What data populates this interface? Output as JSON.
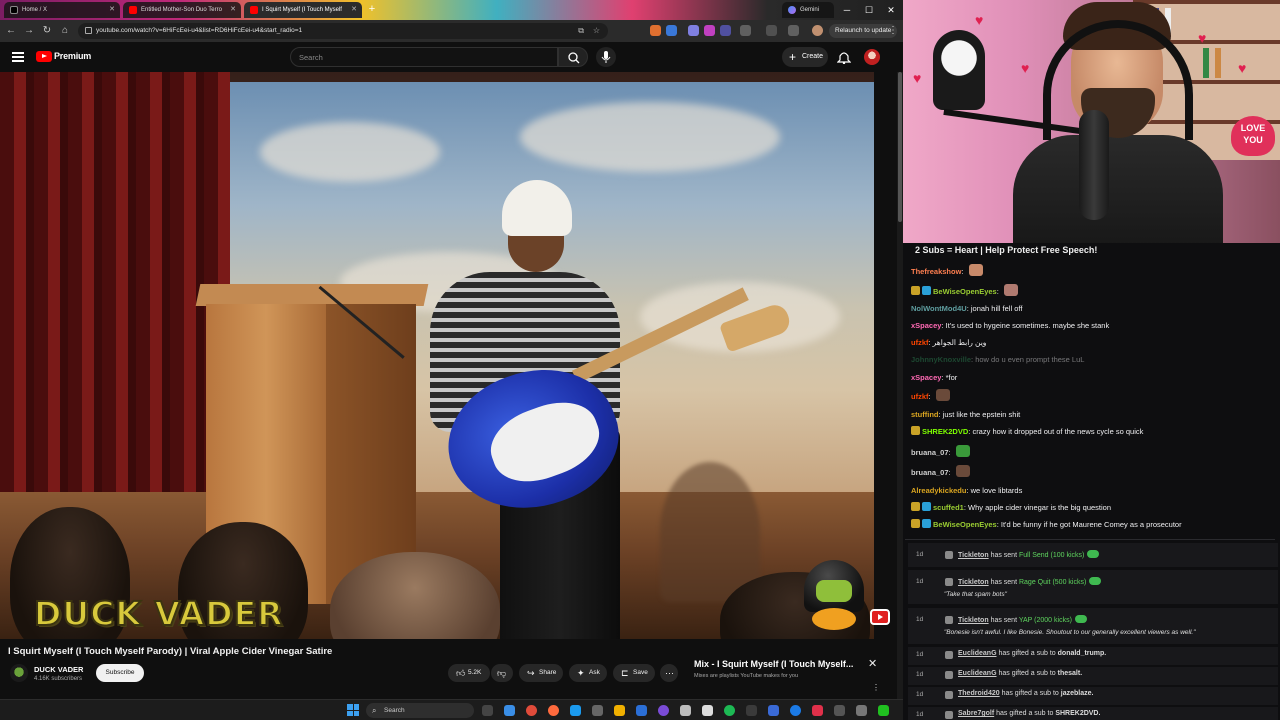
{
  "browser": {
    "tabs": [
      {
        "label": "Home / X",
        "active": false
      },
      {
        "label": "Entitled Mother-Son Duo Terro",
        "active": false
      },
      {
        "label": "I Squirt Myself (I Touch Myself",
        "active": true
      },
      {
        "label": "Gemini",
        "active": false
      }
    ],
    "url": "youtube.com/watch?v=6HiFcEei-u4&list=RD6HiFcEei-u4&start_radio=1",
    "relaunch_label": "Relaunch to update"
  },
  "youtube": {
    "logo_text": "Premium",
    "search_placeholder": "Search",
    "create_label": "Create"
  },
  "video": {
    "watermark": "DUCK VADER",
    "title": "I Squirt Myself (I Touch Myself Parody) | Viral Apple Cider Vinegar Satire",
    "channel": "DUCK VADER",
    "subscribers": "4.16K subscribers",
    "subscribe_label": "Subscribe",
    "likes": "5.2K",
    "share_label": "Share",
    "ask_label": "Ask",
    "save_label": "Save"
  },
  "mix": {
    "title": "Mix - I Squirt Myself (I Touch Myself...",
    "subtitle": "Mixes are playlists YouTube makes for you"
  },
  "taskbar": {
    "search_label": "Search"
  },
  "chat": {
    "banner": "2 Subs = Heart | Help Protect Free Speech!",
    "messages": [
      {
        "user": "Thefreakshow",
        "text": "",
        "color": "#ff7f50",
        "badges": 0,
        "emote": true,
        "dim": false
      },
      {
        "user": "BeWiseOpenEyes",
        "text": "",
        "color": "#9acd32",
        "badges": 2,
        "emote": true,
        "dim": false
      },
      {
        "user": "NolWontMod4U",
        "text": "jonah hill fell off",
        "color": "#5f9ea0",
        "badges": 0,
        "emote": false,
        "dim": false
      },
      {
        "user": "xSpacey",
        "text": "It's used to hygeine sometimes. maybe she stank",
        "color": "#ff69b4",
        "badges": 0,
        "emote": false,
        "dim": false
      },
      {
        "user": "ufzkf",
        "text": "وين رابط الجواهر",
        "color": "#ff4500",
        "badges": 0,
        "emote": false,
        "dim": false
      },
      {
        "user": "JohnnyKnoxville",
        "text": "how do u even prompt these LuL",
        "color": "#2e8b57",
        "badges": 0,
        "emote": false,
        "dim": true
      },
      {
        "user": "xSpacey",
        "text": "*for",
        "color": "#ff69b4",
        "badges": 0,
        "emote": false,
        "dim": false
      },
      {
        "user": "ufzkf",
        "text": "",
        "color": "#ff4500",
        "badges": 0,
        "emote": true,
        "dim": false
      },
      {
        "user": "stuffind",
        "text": "just like the epstein shit",
        "color": "#daa520",
        "badges": 0,
        "emote": false,
        "dim": false
      },
      {
        "user": "SHREK2DVD",
        "text": "crazy how it dropped out of the news cycle so quick",
        "color": "#7fff00",
        "badges": 1,
        "emote": false,
        "dim": false
      },
      {
        "user": "bruana_07",
        "text": "",
        "color": "#d0d0d0",
        "badges": 0,
        "emote": true,
        "dim": false
      },
      {
        "user": "bruana_07",
        "text": "",
        "color": "#d0d0d0",
        "badges": 0,
        "emote": true,
        "dim": false
      },
      {
        "user": "Alreadykickedu",
        "text": "we love libtards",
        "color": "#daa520",
        "badges": 0,
        "emote": false,
        "dim": false
      },
      {
        "user": "scuffed1",
        "text": "Why apple cider vinegar is the big question",
        "color": "#9acd32",
        "badges": 2,
        "emote": false,
        "dim": false
      },
      {
        "user": "BeWiseOpenEyes",
        "text": "It'd be funny if he got Maurene Comey as a prosecutor",
        "color": "#9acd32",
        "badges": 2,
        "emote": false,
        "dim": false
      }
    ],
    "events": [
      {
        "age": "1d",
        "name": "Tickleton",
        "action": "has sent",
        "item": "Full Send (100 kicks)",
        "quote": "",
        "bits": true
      },
      {
        "age": "1d",
        "name": "Tickleton",
        "action": "has sent",
        "item": "Rage Quit (500 kicks)",
        "quote": "\"Take that spam bots\"",
        "bits": true
      },
      {
        "age": "1d",
        "name": "Tickleton",
        "action": "has sent",
        "item": "YAP (2000 kicks)",
        "quote": "\"Bonesie isn't awful. I like Bonesie. Shoutout to our generally excellent viewers as well.\"",
        "bits": true
      },
      {
        "age": "1d",
        "name": "EuclideanG",
        "action": "has gifted a sub to",
        "item": "donald_trump.",
        "quote": "",
        "bits": false
      },
      {
        "age": "1d",
        "name": "EuclideanG",
        "action": "has gifted a sub to",
        "item": "thesalt.",
        "quote": "",
        "bits": false
      },
      {
        "age": "1d",
        "name": "Thedroid420",
        "action": "has gifted a sub to",
        "item": "jazeblaze.",
        "quote": "",
        "bits": false
      },
      {
        "age": "1d",
        "name": "Sabre7golf",
        "action": "has gifted a sub to",
        "item": "SHREK2DVD.",
        "quote": "",
        "bits": false
      }
    ],
    "webcam_sign": "LOVE YOU"
  }
}
